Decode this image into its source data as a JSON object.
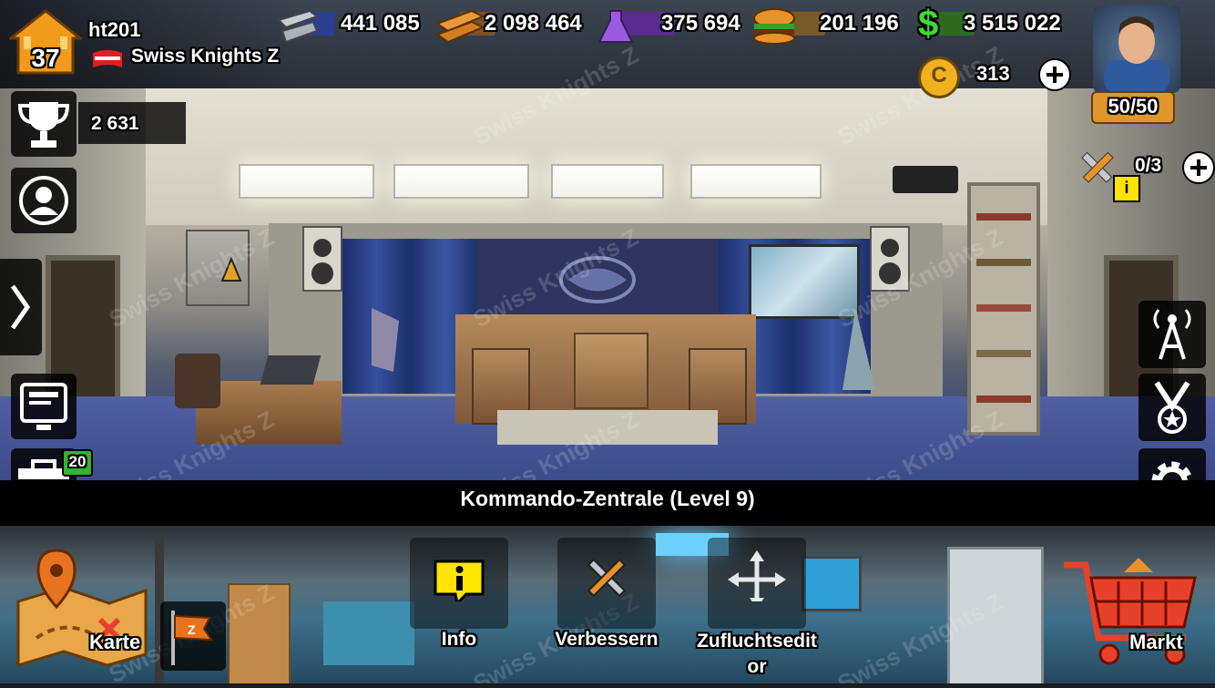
{
  "player": {
    "name": "ht201",
    "level": "37",
    "clan": "Swiss Knights Z"
  },
  "resources": {
    "steel": "441 085",
    "wood": "2 098 464",
    "science": "375 694",
    "food": "201 196",
    "cash": "3 515 022"
  },
  "coins": "313",
  "energy": "50/50",
  "trophies": "2 631",
  "builders": "0/3",
  "garage_badge": "20",
  "room_title": "Kommando-Zentrale (Level 9)",
  "actions": {
    "map": "Karte",
    "info": "Info",
    "upgrade": "Verbessern",
    "editor_line1": "Zufluchtsedit",
    "editor_line2": "or",
    "market": "Markt"
  },
  "watermark": "Swiss Knights Z",
  "colors": {
    "steel_bar": "#2a3f8f",
    "wood_bar": "#7a5128",
    "science_bar": "#5b2c8f",
    "food_bar": "#7a5a2a",
    "cash_bar": "#2d6b1f",
    "coin": "#f0b020",
    "energy_bg": "#e0962a",
    "info_yellow": "#ffe400",
    "badge_green": "#2fb52f",
    "map_orange": "#e8731f",
    "market_red": "#e8412a"
  }
}
